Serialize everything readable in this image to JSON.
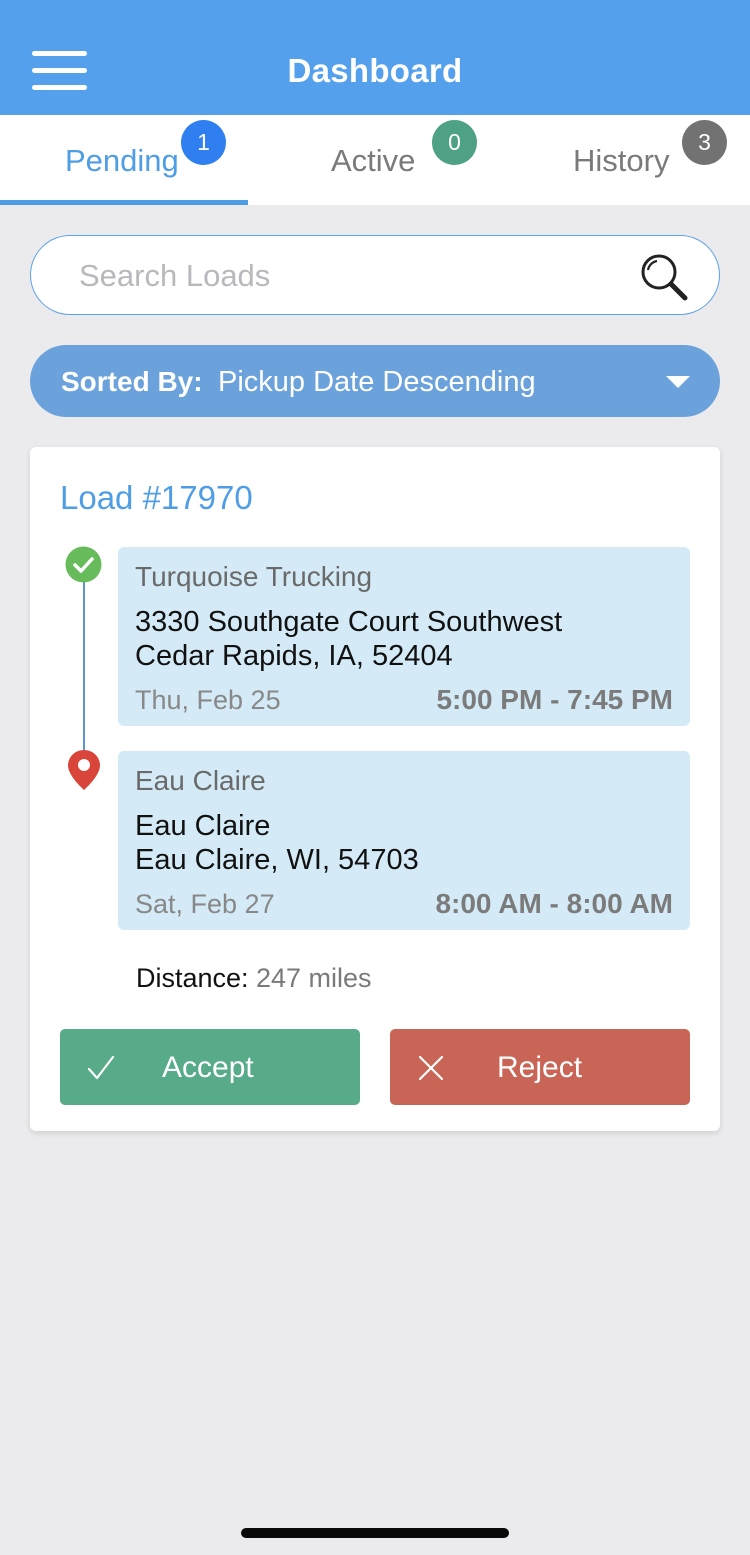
{
  "header": {
    "title": "Dashboard",
    "menu_icon": "hamburger-menu-icon"
  },
  "tabs": [
    {
      "label": "Pending",
      "count": "1",
      "badge_color": "#2f7ff0",
      "active": true
    },
    {
      "label": "Active",
      "count": "0",
      "badge_color": "#4ea184",
      "active": false
    },
    {
      "label": "History",
      "count": "3",
      "badge_color": "#727272",
      "active": false
    }
  ],
  "search": {
    "placeholder": "Search Loads",
    "value": "",
    "icon": "magnifier-icon"
  },
  "sort": {
    "prefix": "Sorted By:",
    "value": "Pickup Date Descending"
  },
  "load": {
    "title": "Load #17970",
    "stops": [
      {
        "name": "Turquoise Trucking",
        "address_line1": "3330 Southgate Court Southwest",
        "address_line2": "Cedar Rapids, IA, 52404",
        "date": "Thu, Feb 25",
        "time": "5:00 PM - 7:45 PM",
        "marker": "check-circle-icon"
      },
      {
        "name": "Eau Claire",
        "address_line1": "Eau Claire",
        "address_line2": "Eau Claire, WI, 54703",
        "date": "Sat, Feb 27",
        "time": "8:00 AM - 8:00 AM",
        "marker": "map-pin-icon"
      }
    ],
    "distance_label": "Distance:",
    "distance_value": "247 miles",
    "accept_label": "Accept",
    "reject_label": "Reject"
  },
  "colors": {
    "header": "#55a0ec",
    "accent": "#4f9ee5",
    "sort_bar": "#6ba2db",
    "stop_bg": "#d4ebf7",
    "accept": "#57ab89",
    "reject": "#c96556",
    "background": "#ebebed"
  }
}
